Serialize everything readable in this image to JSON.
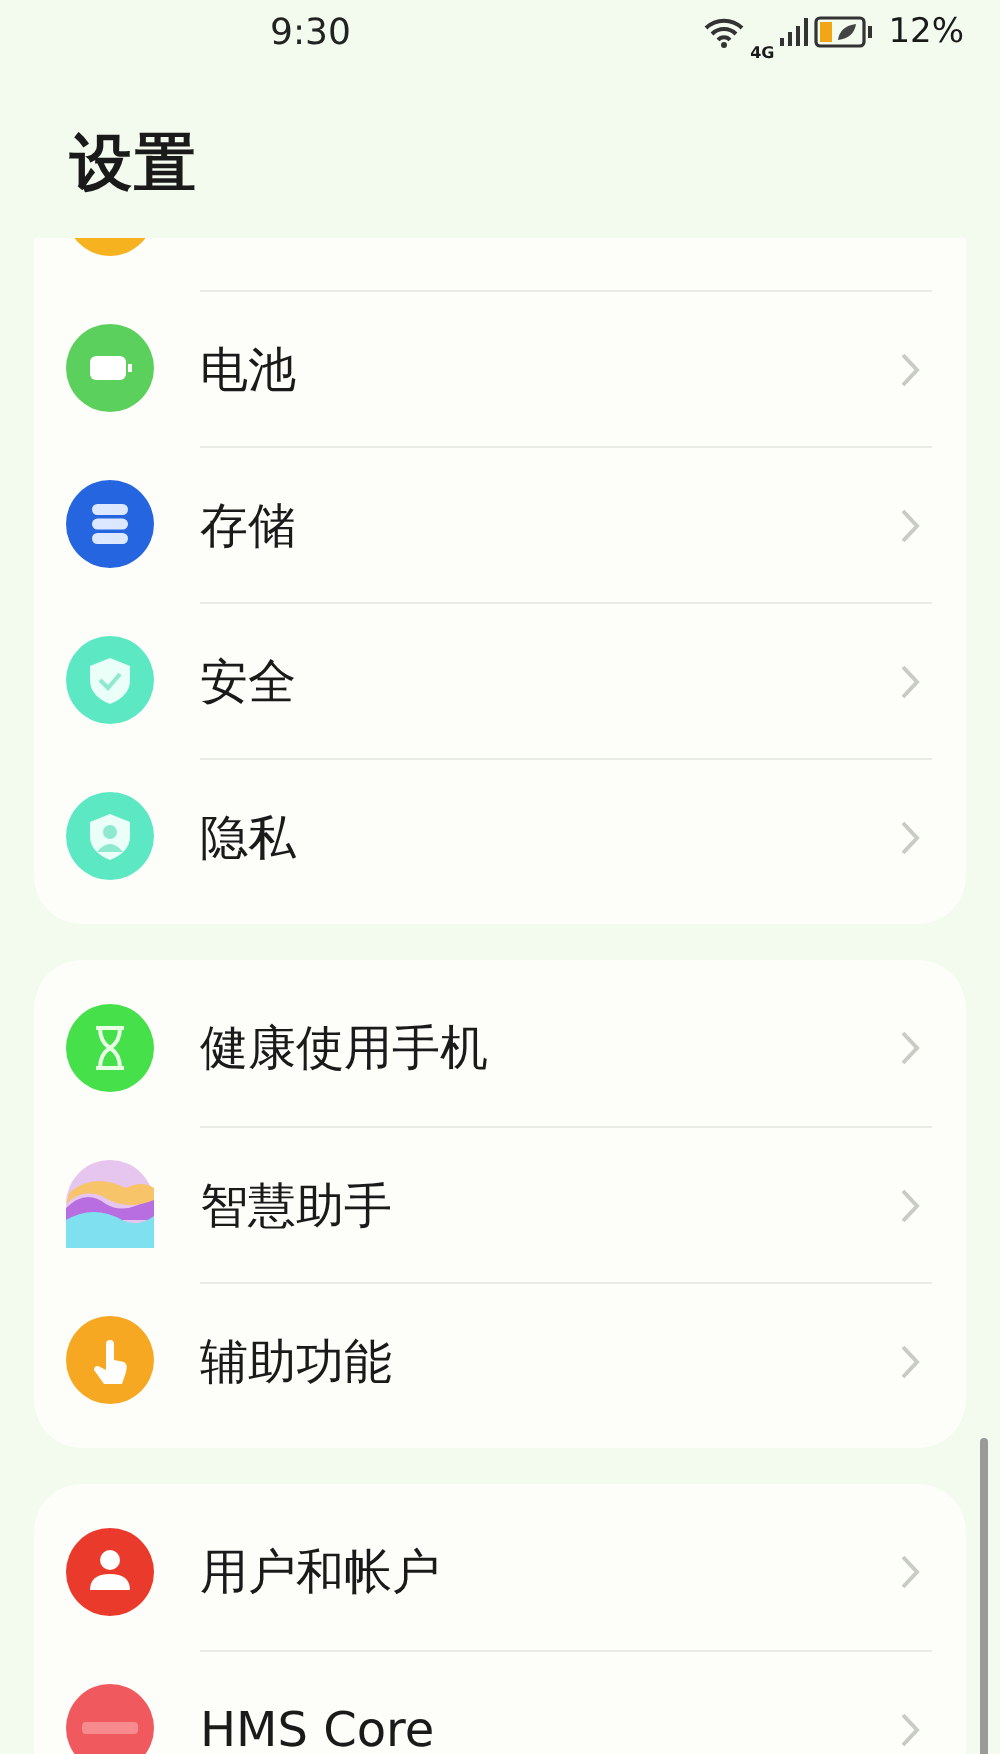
{
  "status_bar": {
    "time": "9:30",
    "network": "4G",
    "battery": "12%"
  },
  "title": "设置",
  "groups": [
    {
      "items": [
        {
          "label": "电池",
          "kind": "battery"
        },
        {
          "label": "存储",
          "kind": "storage"
        },
        {
          "label": "安全",
          "kind": "security"
        },
        {
          "label": "隐私",
          "kind": "privacy"
        }
      ]
    },
    {
      "items": [
        {
          "label": "健康使用手机",
          "kind": "hourglass"
        },
        {
          "label": "智慧助手",
          "kind": "assistant"
        },
        {
          "label": "辅助功能",
          "kind": "accessibility"
        }
      ]
    },
    {
      "items": [
        {
          "label": "用户和帐户",
          "kind": "user"
        },
        {
          "label": "HMS Core",
          "kind": "hms"
        }
      ]
    }
  ]
}
